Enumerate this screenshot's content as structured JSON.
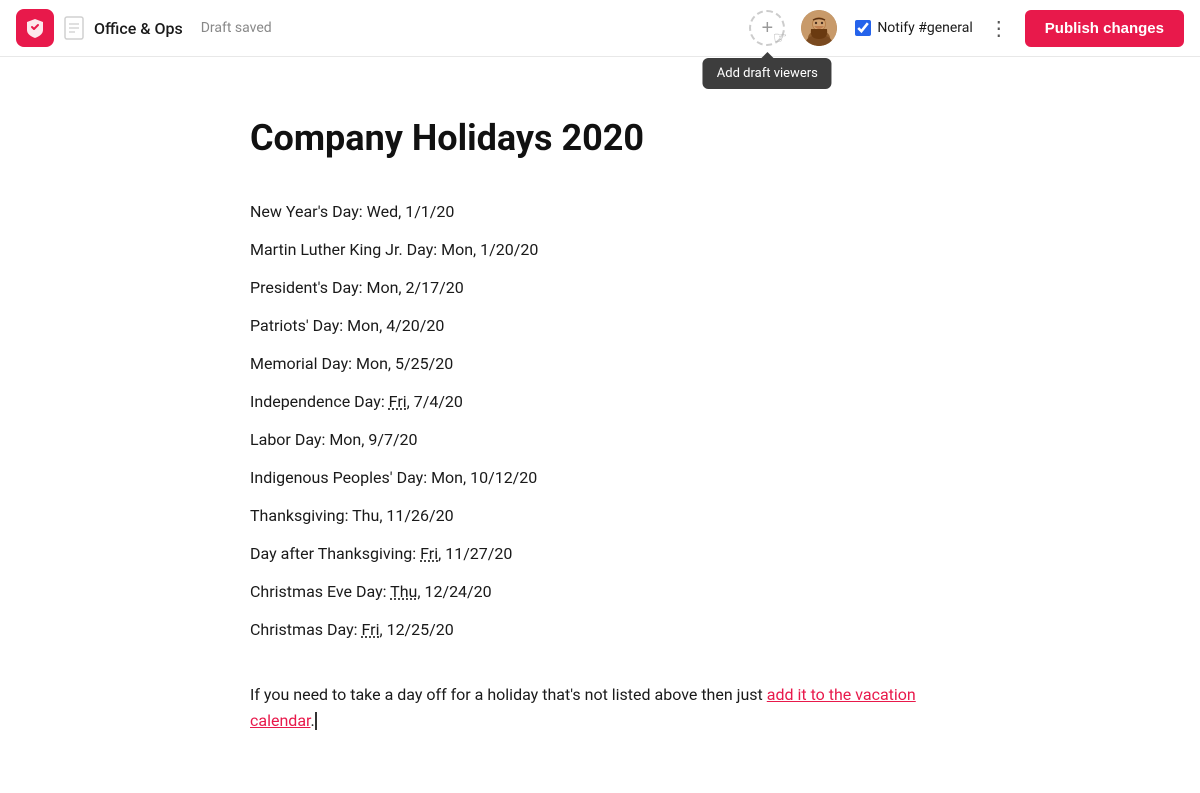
{
  "topbar": {
    "workspace_name": "Office & Ops",
    "draft_status": "Draft saved",
    "add_viewer_tooltip": "Add draft viewers",
    "notify_label": "Notify #general",
    "publish_label": "Publish changes"
  },
  "document": {
    "title": "Company Holidays 2020",
    "holidays": [
      {
        "name": "New Year's Day",
        "date": "Wed, 1/1/20",
        "underline": false
      },
      {
        "name": "Martin Luther King Jr. Day",
        "date": "Mon, 1/20/20",
        "underline": false
      },
      {
        "name": "President's Day",
        "date": "Mon, 2/17/20",
        "underline": false
      },
      {
        "name": "Patriots' Day",
        "date": "Mon, 4/20/20",
        "underline": false
      },
      {
        "name": "Memorial Day",
        "date": "Mon, 5/25/20",
        "underline": false
      },
      {
        "name": "Independence Day",
        "day_abbr": "Fri",
        "date": "7/4/20",
        "underline": true
      },
      {
        "name": "Labor Day",
        "date": "Mon, 9/7/20",
        "underline": false
      },
      {
        "name": "Indigenous Peoples' Day",
        "date": "Mon, 10/12/20",
        "underline": false
      },
      {
        "name": "Thanksgiving",
        "date": "Thu, 11/26/20",
        "underline": false
      },
      {
        "name": "Day after Thanksgiving",
        "day_abbr": "Fri",
        "date": "11/27/20",
        "underline": true
      },
      {
        "name": "Christmas Eve Day",
        "day_abbr": "Thu",
        "date": "12/24/20",
        "underline": true
      },
      {
        "name": "Christmas Day",
        "day_abbr": "Fri",
        "date": "12/25/20",
        "underline": true
      }
    ],
    "footer_text_before_link": "If you need to take a day off for a holiday that's not listed above then just ",
    "footer_link_text": "add it to the vacation calendar",
    "footer_text_after_link": "."
  }
}
